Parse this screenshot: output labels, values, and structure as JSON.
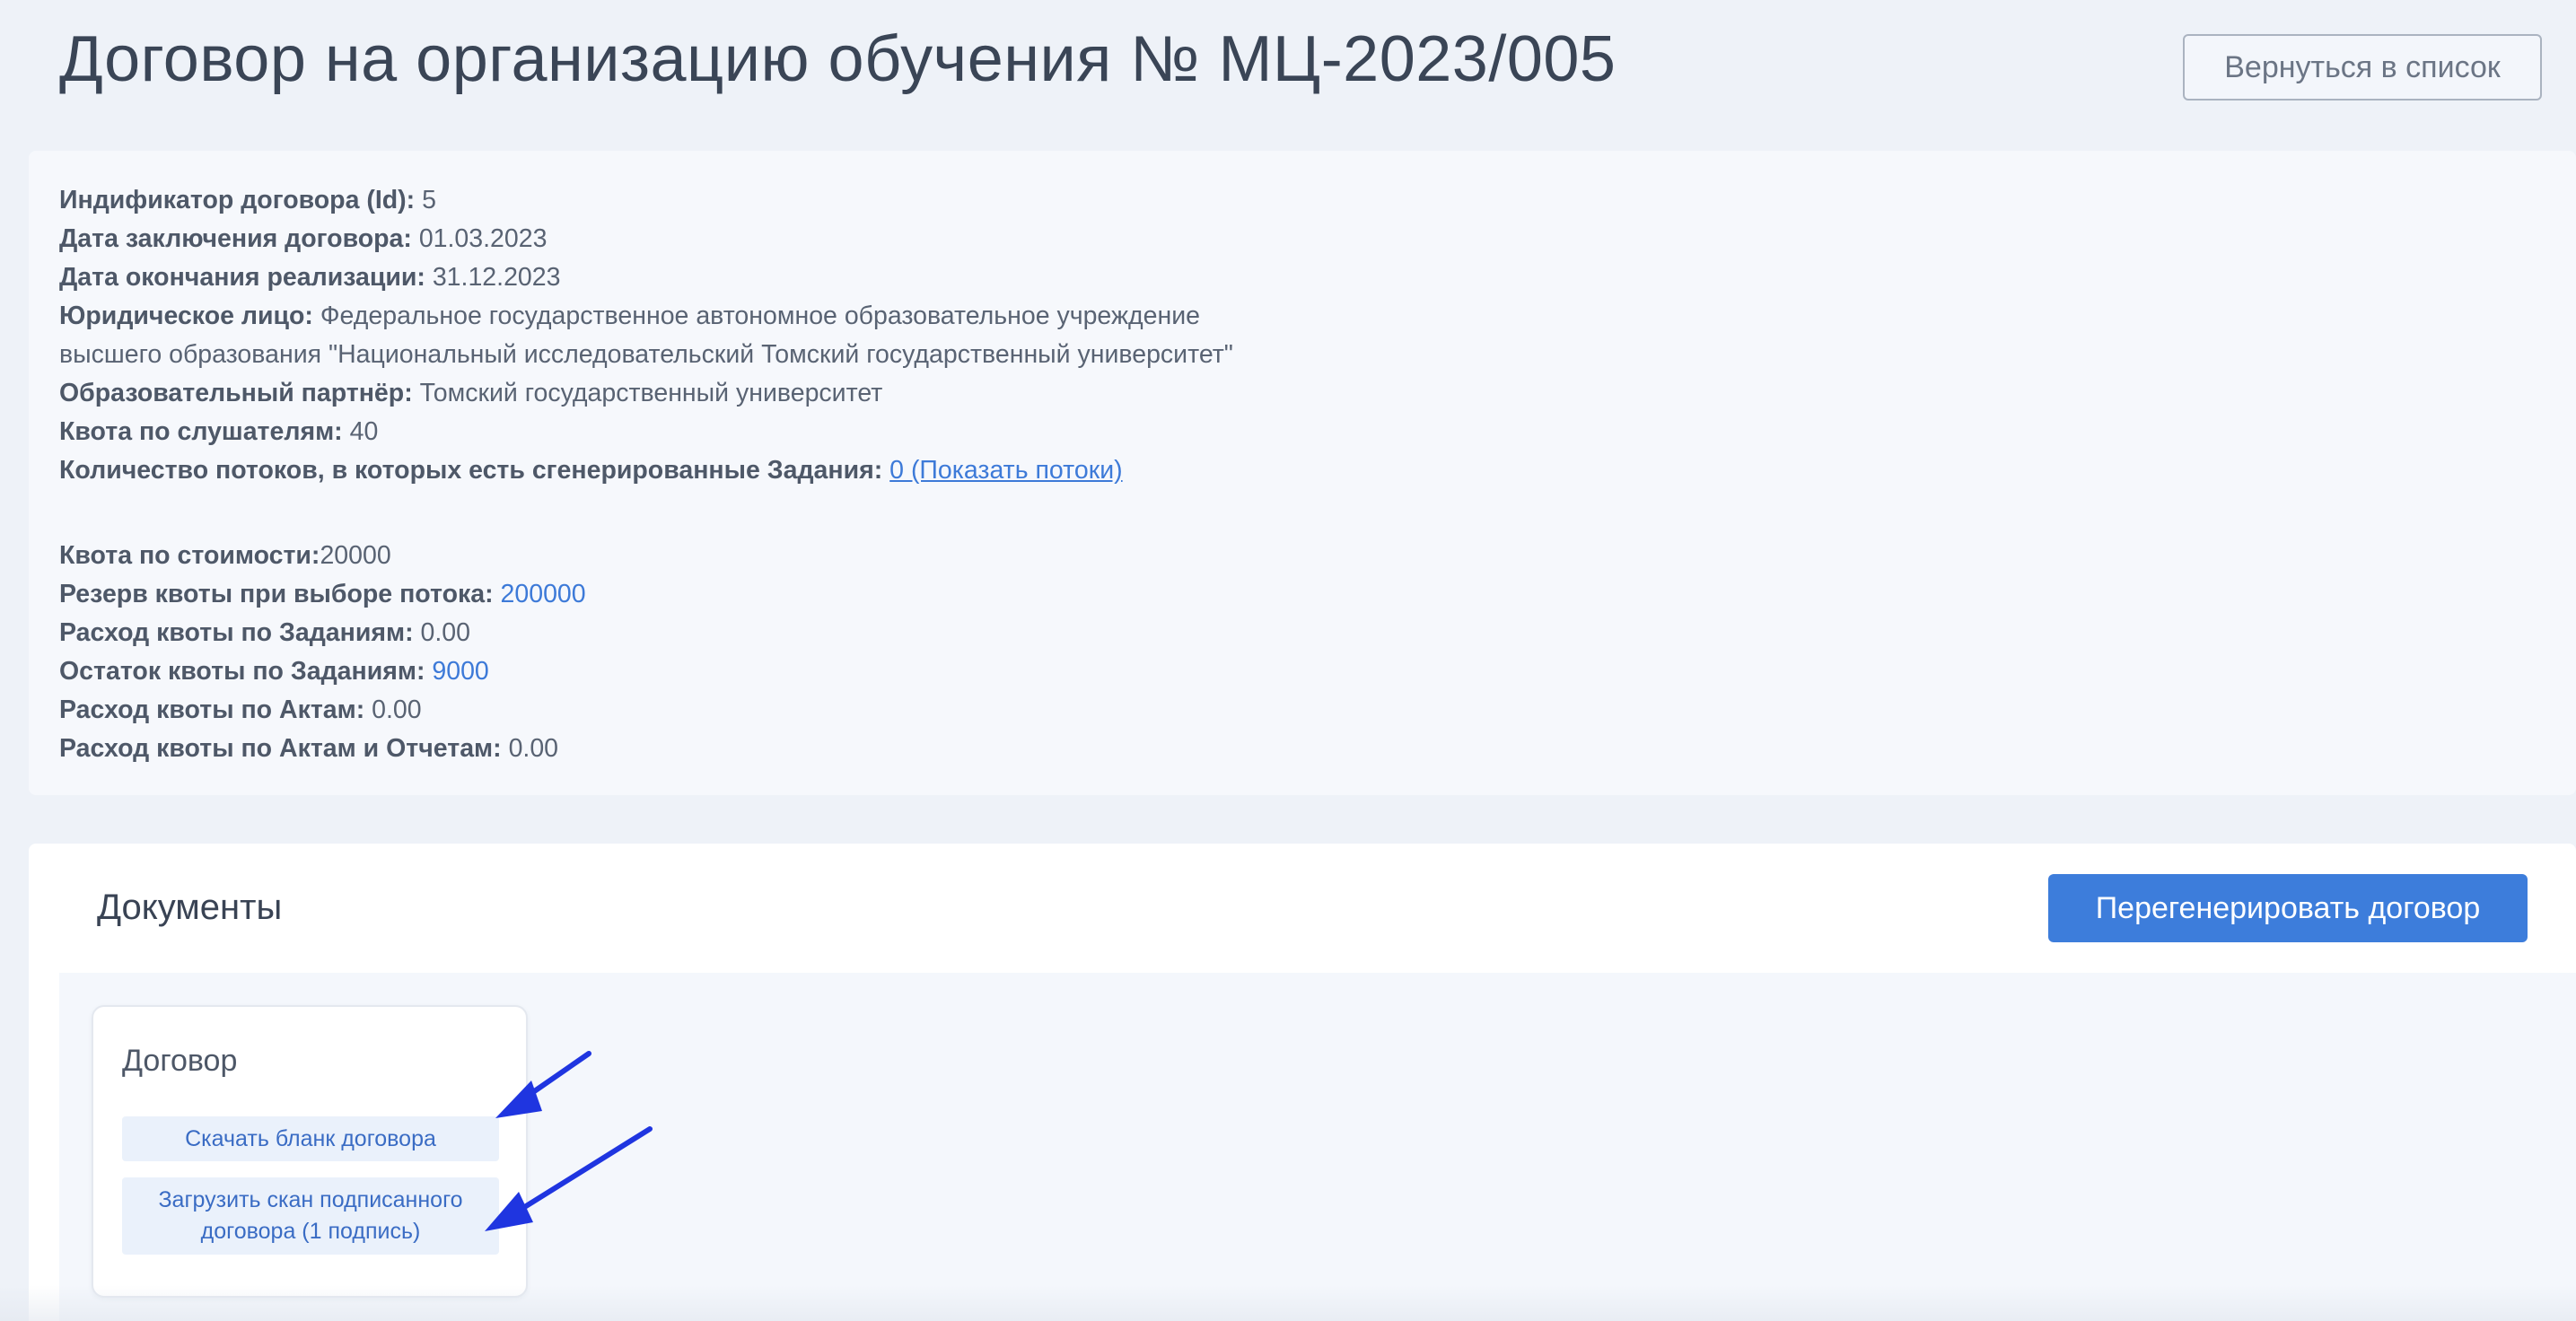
{
  "page_title": "Договор на организацию обучения № МЦ-2023/005",
  "back_button_label": "Вернуться в список",
  "contract_info": {
    "id_label": "Индификатор договора (Id):",
    "id_value": "5",
    "conclusion_date_label": "Дата заключения договора:",
    "conclusion_date_value": "01.03.2023",
    "end_date_label": "Дата окончания реализации:",
    "end_date_value": "31.12.2023",
    "legal_entity_label": "Юридическое лицо:",
    "legal_entity_value_line1": "Федеральное государственное автономное образовательное учреждение",
    "legal_entity_value_line2": "высшего образования \"Национальный исследовательский Томский государственный университет\"",
    "partner_label": "Образовательный партнёр:",
    "partner_value": "Томский государственный университет",
    "listener_quota_label": "Квота по слушателям:",
    "listener_quota_value": "40",
    "streams_label": "Количество потоков, в которых есть сгенерированные Задания:",
    "streams_link": "0 (Показать потоки)"
  },
  "quota_info": {
    "cost_quota_label": "Квота по стоимости:",
    "cost_quota_value": "20000",
    "reserve_label": "Резерв квоты при выборе потока:",
    "reserve_value": "200000",
    "tasks_spend_label": "Расход квоты по Заданиям:",
    "tasks_spend_value": "0.00",
    "tasks_remainder_label": "Остаток квоты по Заданиям:",
    "tasks_remainder_value": "9000",
    "acts_spend_label": "Расход квоты по Актам:",
    "acts_spend_value": "0.00",
    "acts_reports_spend_label": "Расход квоты по Актам и Отчетам:",
    "acts_reports_spend_value": "0.00"
  },
  "documents": {
    "heading": "Документы",
    "regenerate_button_label": "Перегенерировать договор",
    "card": {
      "title": "Договор",
      "download_label": "Скачать бланк договора",
      "upload_label": "Загрузить скан подписанного договора (1 подпись)"
    }
  },
  "colors": {
    "accent": "#3d7ddb",
    "link": "#3d7ad8",
    "annotation_arrow": "#1f35e0"
  }
}
